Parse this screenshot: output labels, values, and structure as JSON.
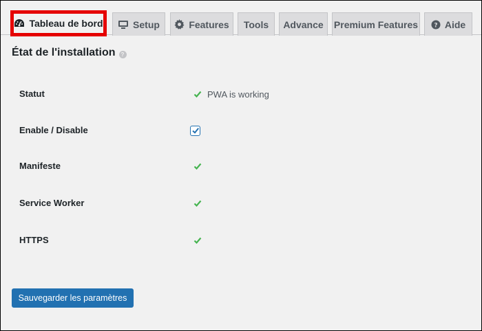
{
  "tabs": [
    {
      "label": "Tableau de bord",
      "icon": "dashboard-gauge-icon",
      "active": true
    },
    {
      "label": "Setup",
      "icon": "monitor-icon"
    },
    {
      "label": "Features",
      "icon": "gear-icon"
    },
    {
      "label": "Tools"
    },
    {
      "label": "Advance"
    },
    {
      "label": "Premium Features"
    },
    {
      "label": "Aide",
      "icon": "question-circle-icon"
    }
  ],
  "section": {
    "title": "État de l'installation",
    "help_icon": "help-icon"
  },
  "rows": [
    {
      "label": "Statut",
      "value": "PWA is working",
      "type": "check-text"
    },
    {
      "label": "Enable / Disable",
      "type": "checkbox",
      "checked": true
    },
    {
      "label": "Manifeste",
      "type": "check"
    },
    {
      "label": "Service Worker",
      "type": "check"
    },
    {
      "label": "HTTPS",
      "type": "check"
    }
  ],
  "save_button": {
    "label": "Sauvegarder les paramètres"
  },
  "colors": {
    "accent": "#2271b1",
    "check_green": "#46b450",
    "highlight_red": "#e50000"
  }
}
